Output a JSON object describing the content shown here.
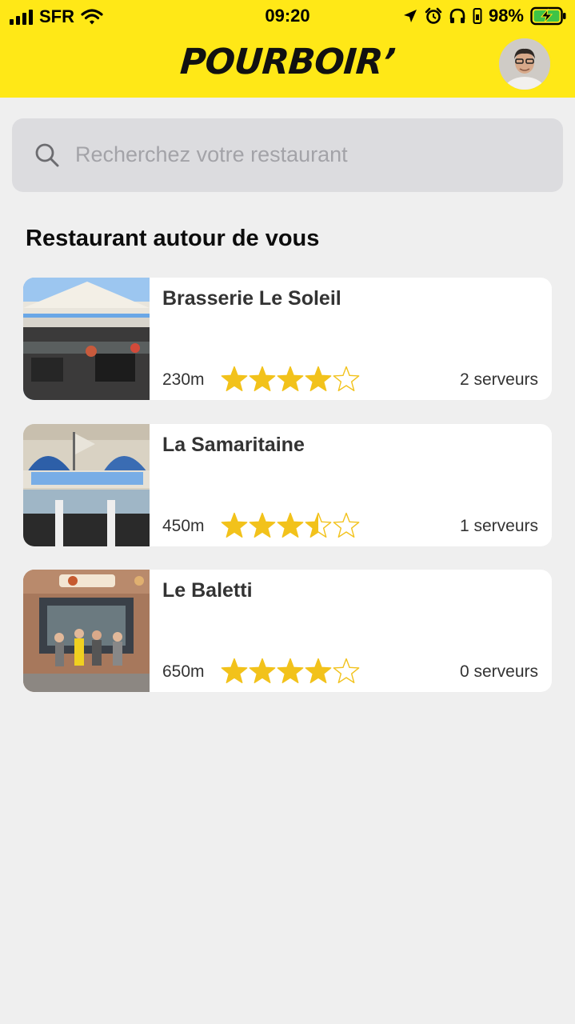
{
  "status_bar": {
    "carrier": "SFR",
    "time": "09:20",
    "battery": "98%"
  },
  "header": {
    "logo_text": "POURBOIR’",
    "accent_color": "#ffe817"
  },
  "search": {
    "placeholder": "Recherchez votre restaurant"
  },
  "section": {
    "title": "Restaurant autour de vous"
  },
  "restaurants": [
    {
      "name": "Brasserie Le Soleil",
      "distance": "230m",
      "rating": 4,
      "servers": "2 serveurs"
    },
    {
      "name": "La Samaritaine",
      "distance": "450m",
      "rating": 3.5,
      "servers": "1 serveurs"
    },
    {
      "name": "Le Baletti",
      "distance": "650m",
      "rating": 4,
      "servers": "0 serveurs"
    }
  ],
  "star_color": "#f2c21b"
}
